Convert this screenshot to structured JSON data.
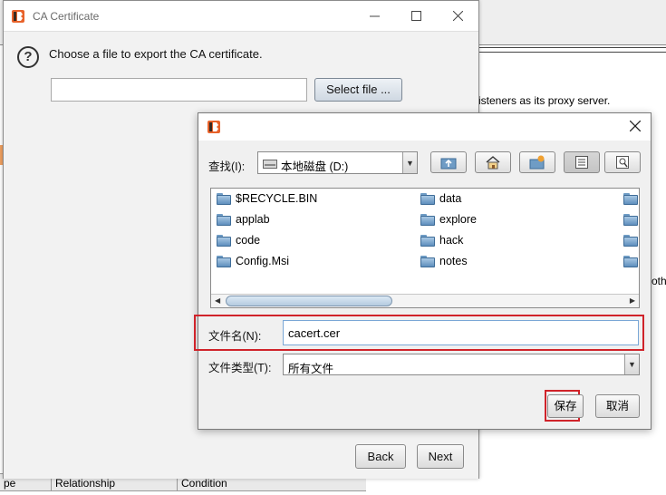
{
  "background": {
    "proxy_text": "isteners as its proxy server.",
    "side_text": "oth",
    "table_headers": [
      "pe",
      "Relationship",
      "Condition"
    ]
  },
  "wizard": {
    "title": "CA Certificate",
    "prompt": "Choose a file to export the CA certificate.",
    "path_value": "",
    "select_file_label": "Select file ...",
    "back_label": "Back",
    "next_label": "Next",
    "question_glyph": "?"
  },
  "save_dialog": {
    "look_in_label": "查找(I):",
    "look_in_value": "本地磁盘 (D:)",
    "toolbar_icons": [
      "up-folder-icon",
      "home-icon",
      "new-folder-icon",
      "list-view-icon",
      "details-view-icon"
    ],
    "files": [
      "$RECYCLE.BIN",
      "applab",
      "code",
      "Config.Msi",
      "data",
      "explore",
      "hack",
      "notes"
    ],
    "filename_label": "文件名(N):",
    "filename_value": "cacert.cer",
    "filetype_label": "文件类型(T):",
    "filetype_value": "所有文件",
    "save_label": "保存",
    "cancel_label": "取消"
  },
  "colors": {
    "highlight_red": "#d0232a",
    "app_icon_orange": "#e8622a",
    "folder_blue": "#5f8fbd"
  }
}
